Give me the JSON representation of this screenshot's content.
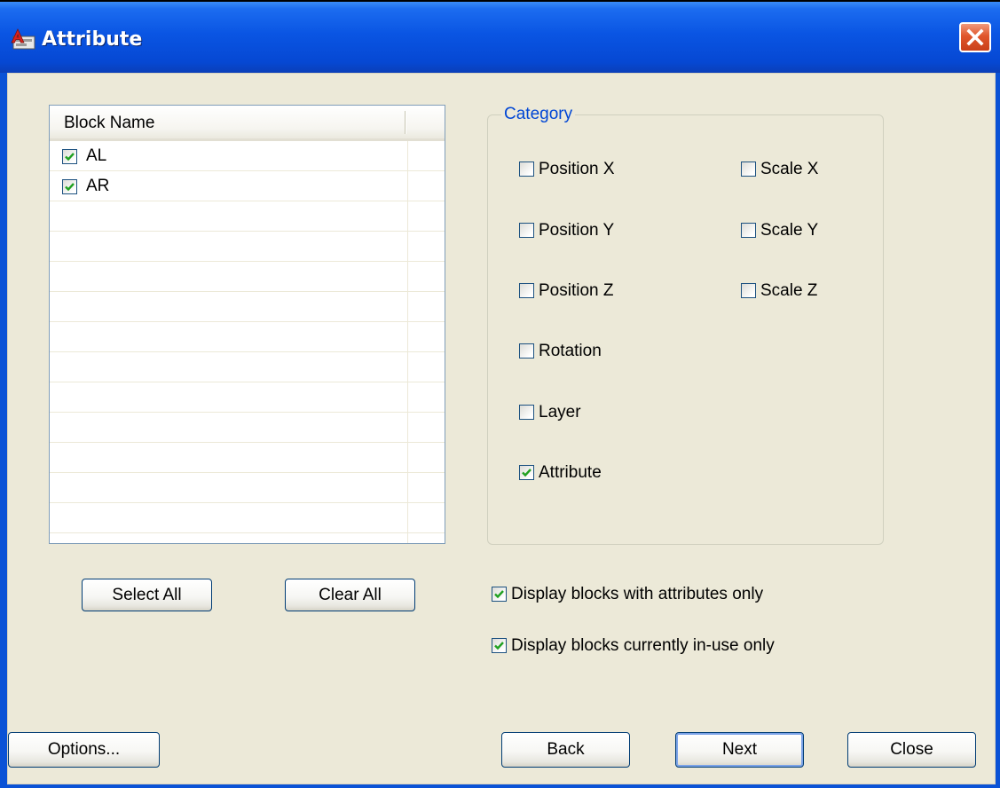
{
  "window": {
    "title": "Attribute"
  },
  "block_list": {
    "column_header": "Block Name",
    "items": [
      {
        "label": "AL",
        "checked": true
      },
      {
        "label": "AR",
        "checked": true
      }
    ]
  },
  "list_buttons": {
    "select_all": "Select All",
    "clear_all": "Clear All"
  },
  "category": {
    "title": "Category",
    "options": [
      {
        "label": "Position X",
        "checked": false
      },
      {
        "label": "Position Y",
        "checked": false
      },
      {
        "label": "Position Z",
        "checked": false
      },
      {
        "label": "Rotation",
        "checked": false
      },
      {
        "label": "Layer",
        "checked": false
      },
      {
        "label": "Attribute",
        "checked": true
      },
      {
        "label": "Scale X",
        "checked": false
      },
      {
        "label": "Scale Y",
        "checked": false
      },
      {
        "label": "Scale Z",
        "checked": false
      }
    ]
  },
  "filters": {
    "attributes_only": {
      "label": "Display blocks with attributes only",
      "checked": true
    },
    "in_use_only": {
      "label": "Display blocks currently in-use only",
      "checked": true
    }
  },
  "footer": {
    "options": "Options...",
    "back": "Back",
    "next": "Next",
    "close": "Close"
  },
  "colors": {
    "titlebar": "#0a55e3",
    "dialog_bg": "#ece9d8",
    "group_label": "#0046d5",
    "check_mark": "#21a121"
  }
}
